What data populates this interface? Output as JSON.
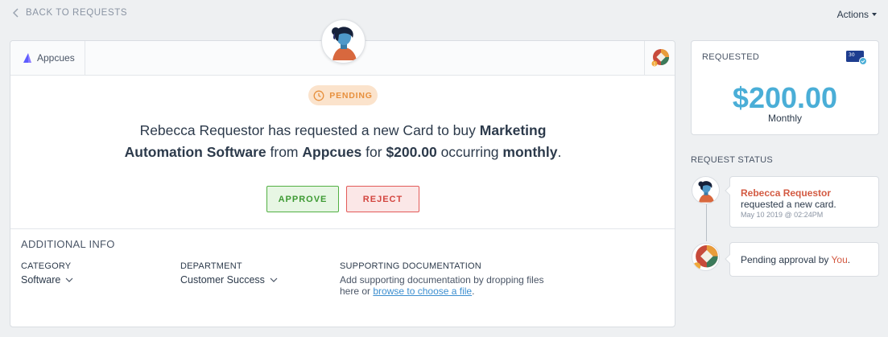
{
  "nav": {
    "back_label": "BACK TO REQUESTS",
    "actions_label": "Actions"
  },
  "vendor": {
    "name": "Appcues"
  },
  "status_badge": "PENDING",
  "request": {
    "pre": "Rebecca Requestor has requested a new Card to buy ",
    "item": "Marketing Automation Software",
    "from": " from ",
    "vendor": "Appcues",
    "for": " for ",
    "amount": "$200.00",
    "occurring": " occurring ",
    "frequency": "monthly",
    "end": "."
  },
  "buttons": {
    "approve": "APPROVE",
    "reject": "REJECT"
  },
  "info": {
    "title": "ADDITIONAL INFO",
    "category_label": "CATEGORY",
    "category_value": "Software",
    "department_label": "DEPARTMENT",
    "department_value": "Customer Success",
    "docs_label": "SUPPORTING DOCUMENTATION",
    "docs_text": "Add supporting documentation by dropping files here or ",
    "docs_link": "browse to choose a file",
    "docs_end": "."
  },
  "requested": {
    "label": "REQUESTED",
    "card_badge": "30",
    "amount": "$200.00",
    "frequency": "Monthly"
  },
  "request_status": {
    "title": "REQUEST STATUS",
    "events": [
      {
        "name": "Rebecca Requestor",
        "text": "requested a new card.",
        "date": "May 10 2019 @ 02:24PM"
      },
      {
        "text": "Pending approval by ",
        "highlight": "You",
        "end": "."
      }
    ]
  },
  "colors": {
    "accent_blue": "#4aaed7",
    "pending_orange": "#e7903e",
    "approve_green": "#3d9a33",
    "reject_red": "#d3453f",
    "name_red": "#d35a42"
  }
}
